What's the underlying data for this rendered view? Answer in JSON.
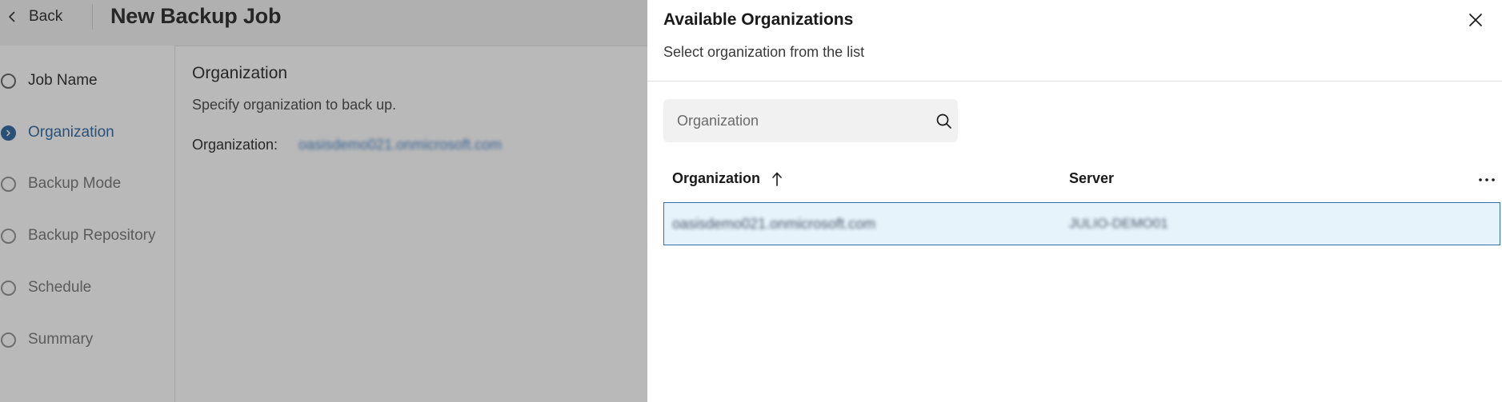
{
  "wizard": {
    "back_label": "Back",
    "title": "New Backup Job",
    "steps": [
      {
        "label": "Job Name",
        "state": "done"
      },
      {
        "label": "Organization",
        "state": "active"
      },
      {
        "label": "Backup Mode",
        "state": "pending"
      },
      {
        "label": "Backup Repository",
        "state": "pending"
      },
      {
        "label": "Schedule",
        "state": "pending"
      },
      {
        "label": "Summary",
        "state": "pending"
      }
    ],
    "section": {
      "title": "Organization",
      "subtitle": "Specify organization to back up.",
      "field_label": "Organization:",
      "field_value": "oasisdemo021.onmicrosoft.com"
    }
  },
  "panel": {
    "title": "Available Organizations",
    "subtitle": "Select organization from the list",
    "search": {
      "placeholder": "Organization",
      "value": ""
    },
    "columns": {
      "organization": "Organization",
      "server": "Server"
    },
    "sort_column": "Organization",
    "sort_direction": "ascending",
    "rows": [
      {
        "organization": "oasisdemo021.onmicrosoft.com",
        "server": "JULIO-DEMO01",
        "selected": true
      }
    ]
  },
  "colors": {
    "accent": "#1f5d9a",
    "link": "#3c7bc6",
    "selected_row_bg": "#e7f3fb",
    "selected_row_border": "#2f6fa7"
  },
  "icons": {
    "back": "chevron-left-icon",
    "step_active": "chevron-right-icon",
    "close": "close-icon",
    "search": "search-icon",
    "sort": "arrow-up-icon",
    "more": "more-horizontal-icon"
  }
}
